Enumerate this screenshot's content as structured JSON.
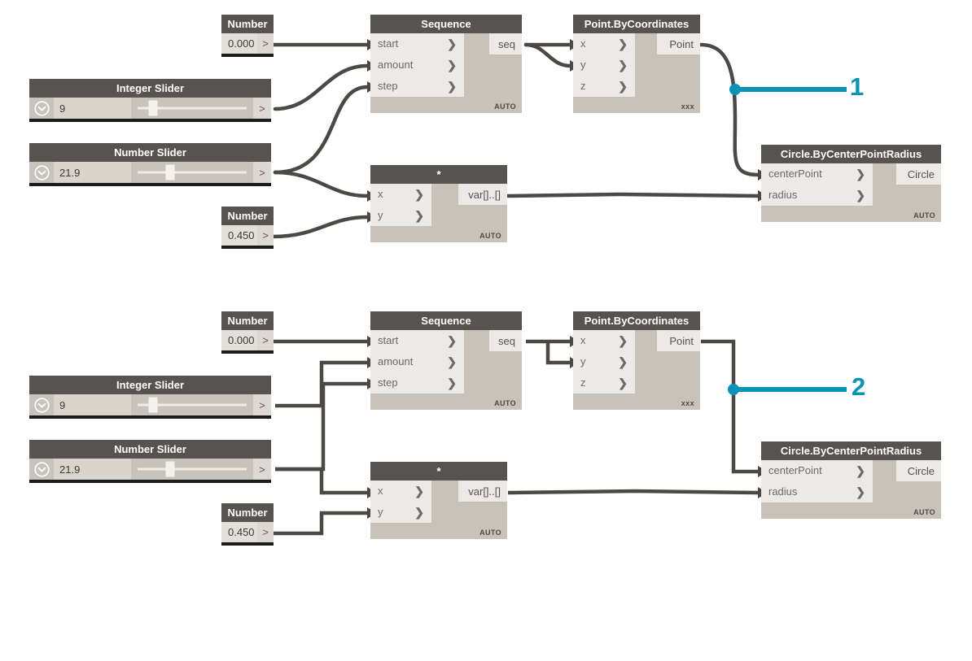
{
  "app": {
    "title": "Dynamo Node Graph",
    "background_color": "#ffffff",
    "wire_color": "#4b4846",
    "accent_color": "#0b93b5",
    "node_header_color": "#565351",
    "node_body_color": "#c8c2b8",
    "port_color": "#eceae6"
  },
  "diagrams": [
    {
      "id": "diagram-1",
      "wire_style": "curved",
      "callout": {
        "label": "1",
        "color": "#0b93b5"
      },
      "nodes": {
        "number_start": {
          "type": "Number",
          "title": "Number",
          "value": "0.000",
          "port_label": ">"
        },
        "integer_slider": {
          "type": "Integer Slider",
          "title": "Integer Slider",
          "value": "9",
          "port_label": ">",
          "caret_icon": "chevron-down-circle-icon",
          "handle_percent": 18
        },
        "number_slider": {
          "type": "Number Slider",
          "title": "Number Slider",
          "value": "21.9",
          "port_label": ">",
          "caret_icon": "chevron-down-circle-icon",
          "handle_percent": 32
        },
        "number_factor": {
          "type": "Number",
          "title": "Number",
          "value": "0.450",
          "port_label": ">"
        },
        "sequence": {
          "type": "Sequence",
          "title": "Sequence",
          "inputs": [
            "start",
            "amount",
            "step"
          ],
          "output": "seq",
          "tag": "AUTO"
        },
        "point": {
          "type": "Point.ByCoordinates",
          "title": "Point.ByCoordinates",
          "inputs": [
            "x",
            "y",
            "z"
          ],
          "output": "Point",
          "tag": "xxx"
        },
        "multiply": {
          "type": "Multiply",
          "title": "*",
          "inputs": [
            "x",
            "y"
          ],
          "output": "var[]..[]",
          "tag": "AUTO"
        },
        "circle": {
          "type": "Circle.ByCenterPointRadius",
          "title": "Circle.ByCenterPointRadius",
          "inputs": [
            "centerPoint",
            "radius"
          ],
          "output": "Circle",
          "tag": "AUTO"
        }
      }
    },
    {
      "id": "diagram-2",
      "wire_style": "orthogonal",
      "callout": {
        "label": "2",
        "color": "#0b93b5"
      },
      "nodes": {
        "number_start": {
          "type": "Number",
          "title": "Number",
          "value": "0.000",
          "port_label": ">"
        },
        "integer_slider": {
          "type": "Integer Slider",
          "title": "Integer Slider",
          "value": "9",
          "port_label": ">",
          "caret_icon": "chevron-down-circle-icon",
          "handle_percent": 18
        },
        "number_slider": {
          "type": "Number Slider",
          "title": "Number Slider",
          "value": "21.9",
          "port_label": ">",
          "caret_icon": "chevron-down-circle-icon",
          "handle_percent": 32
        },
        "number_factor": {
          "type": "Number",
          "title": "Number",
          "value": "0.450",
          "port_label": ">"
        },
        "sequence": {
          "type": "Sequence",
          "title": "Sequence",
          "inputs": [
            "start",
            "amount",
            "step"
          ],
          "output": "seq",
          "tag": "AUTO"
        },
        "point": {
          "type": "Point.ByCoordinates",
          "title": "Point.ByCoordinates",
          "inputs": [
            "x",
            "y",
            "z"
          ],
          "output": "Point",
          "tag": "xxx"
        },
        "multiply": {
          "type": "Multiply",
          "title": "*",
          "inputs": [
            "x",
            "y"
          ],
          "output": "var[]..[]",
          "tag": "AUTO"
        },
        "circle": {
          "type": "Circle.ByCenterPointRadius",
          "title": "Circle.ByCenterPointRadius",
          "inputs": [
            "centerPoint",
            "radius"
          ],
          "output": "Circle",
          "tag": "AUTO"
        }
      }
    }
  ],
  "chevron_glyph": "❯"
}
